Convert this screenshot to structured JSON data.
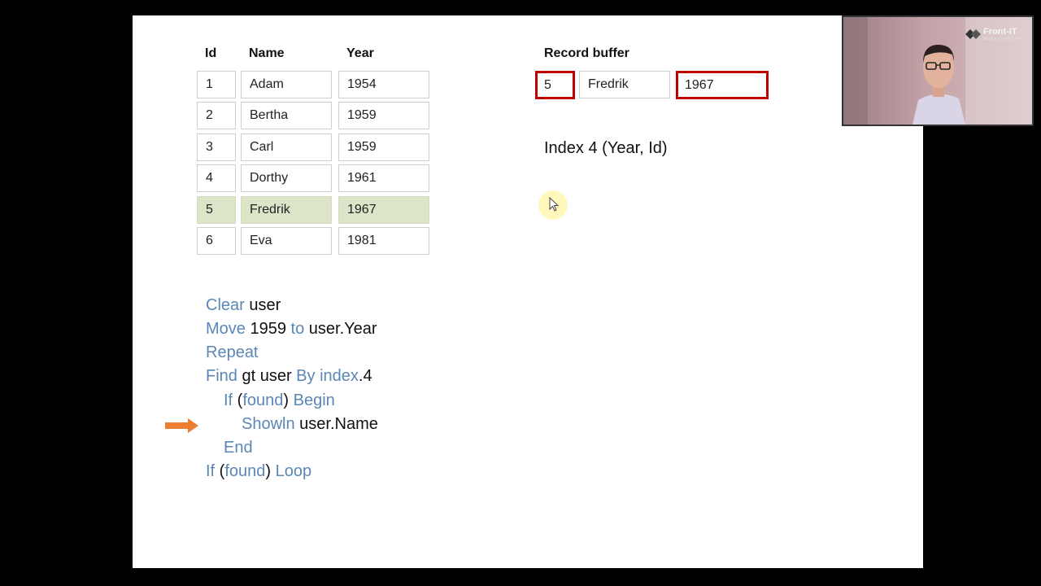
{
  "table": {
    "headers": [
      "Id",
      "Name",
      "Year"
    ],
    "rows": [
      [
        "1",
        "Adam",
        "1954"
      ],
      [
        "2",
        "Bertha",
        "1959"
      ],
      [
        "3",
        "Carl",
        "1959"
      ],
      [
        "4",
        "Dorthy",
        "1961"
      ],
      [
        "5",
        "Fredrik",
        "1967"
      ],
      [
        "6",
        "Eva",
        "1981"
      ]
    ],
    "highlight_color": "#dde5c8"
  },
  "record_buffer": {
    "title": "Record buffer",
    "id": "5",
    "name": "Fredrik",
    "year": "1967",
    "outline_color": "#c00000"
  },
  "index_title": "Index 4 (Year, Id)",
  "code": {
    "keyword_color": "#5b87b6",
    "l1_kw": "Clear",
    "l1_t": " user",
    "l2_kw": "Move",
    "l2_t1": " 1959 ",
    "l2_kw2": "to",
    "l2_t2": " user.Year",
    "l3_kw": "Repeat",
    "l4_kw": "Find",
    "l4_t1": " gt user ",
    "l4_kw2": "By index",
    "l4_t2": ".4",
    "l5_kw": "If",
    "l5_t1": " (",
    "l5_kw2": "found",
    "l5_t2": ") ",
    "l5_kw3": "Begin",
    "l6_kw": "Showln",
    "l6_t": " user.Name",
    "l7_kw": "End",
    "l8_kw": "If",
    "l8_t1": " (",
    "l8_kw2": "found",
    "l8_t2": ") ",
    "l8_kw3": "Loop"
  },
  "arrow_color": "#ed7d31",
  "webcam": {
    "logo_text": "Front-IT",
    "logo_sub": "Business Intelligence"
  }
}
